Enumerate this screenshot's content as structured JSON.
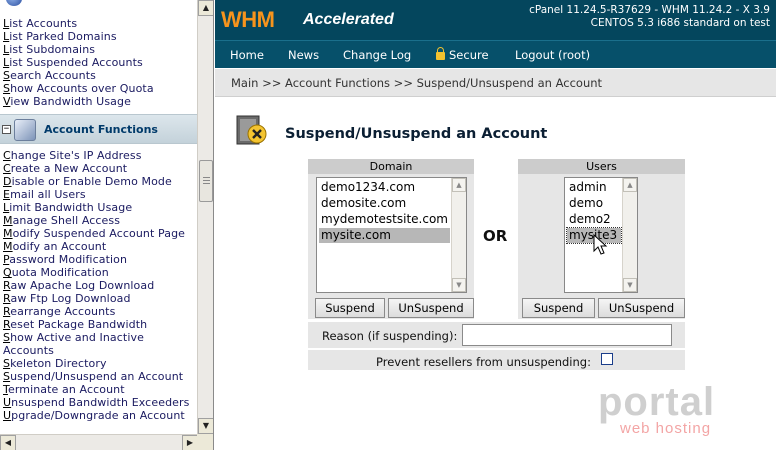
{
  "sidebar": {
    "links_top": [
      {
        "k": "L",
        "rest": "ist Accounts"
      },
      {
        "k": "L",
        "rest": "ist Parked Domains"
      },
      {
        "k": "L",
        "rest": "ist Subdomains"
      },
      {
        "k": "L",
        "rest": "ist Suspended Accounts"
      },
      {
        "k": "S",
        "rest": "earch Accounts"
      },
      {
        "k": "S",
        "rest": "how Accounts over Quota"
      },
      {
        "k": "V",
        "rest": "iew Bandwidth Usage"
      }
    ],
    "section_title": "Account Functions",
    "links": [
      {
        "k": "C",
        "rest": "hange Site's IP Address"
      },
      {
        "k": "C",
        "rest": "reate a New Account"
      },
      {
        "k": "D",
        "rest": "isable or Enable Demo Mode"
      },
      {
        "k": "E",
        "rest": "mail all Users"
      },
      {
        "k": "L",
        "rest": "imit Bandwidth Usage"
      },
      {
        "k": "M",
        "rest": "anage Shell Access"
      },
      {
        "k": "M",
        "rest": "odify Suspended Account Page"
      },
      {
        "k": "M",
        "rest": "odify an Account"
      },
      {
        "k": "P",
        "rest": "assword Modification"
      },
      {
        "k": "Q",
        "rest": "uota Modification"
      },
      {
        "k": "R",
        "rest": "aw Apache Log Download"
      },
      {
        "k": "R",
        "rest": "aw Ftp Log Download"
      },
      {
        "k": "R",
        "rest": "earrange Accounts"
      },
      {
        "k": "R",
        "rest": "eset Package Bandwidth"
      },
      {
        "k": "S",
        "rest": "how Active and Inactive"
      },
      {
        "k": "",
        "rest": "Accounts"
      },
      {
        "k": "S",
        "rest": "keleton Directory"
      },
      {
        "k": "S",
        "rest": "uspend/Unsuspend an Account"
      },
      {
        "k": "T",
        "rest": "erminate an Account"
      },
      {
        "k": "U",
        "rest": "nsuspend Bandwidth Exceeders"
      },
      {
        "k": "U",
        "rest": "pgrade/Downgrade an Account"
      }
    ]
  },
  "header": {
    "logo": "WHM",
    "logo_sub": "Accelerated",
    "version_line1": "cPanel 11.24.5-R37629 - WHM 11.24.2 - X 3.9",
    "version_line2": "CENTOS 5.3 i686 standard on test"
  },
  "menu": {
    "home": "Home",
    "news": "News",
    "changelog": "Change Log",
    "secure": "Secure",
    "logout": "Logout (root)"
  },
  "breadcrumb": "Main >> Account Functions >> Suspend/Unsuspend an Account",
  "page_title": "Suspend/Unsuspend an Account",
  "domain_panel": {
    "header": "Domain",
    "options": [
      "demo1234.com",
      "demosite.com",
      "mydemotestsite.com",
      "mysite.com"
    ],
    "selected_index": 3,
    "suspend_label": "Suspend",
    "unsuspend_label": "UnSuspend"
  },
  "or_label": "OR",
  "users_panel": {
    "header": "Users",
    "options": [
      "admin",
      "demo",
      "demo2",
      "mysite3"
    ],
    "selected_index": 3,
    "suspend_label": "Suspend",
    "unsuspend_label": "UnSuspend"
  },
  "reason": {
    "label": "Reason (if suspending):",
    "value": ""
  },
  "prevent": {
    "label": "Prevent resellers from unsuspending:",
    "checked": false
  },
  "watermark": {
    "big": "portal",
    "small": "web hosting"
  },
  "colors": {
    "header_bg": "#04465d",
    "logo": "#f7941d",
    "selection": "#b7b7b7"
  }
}
